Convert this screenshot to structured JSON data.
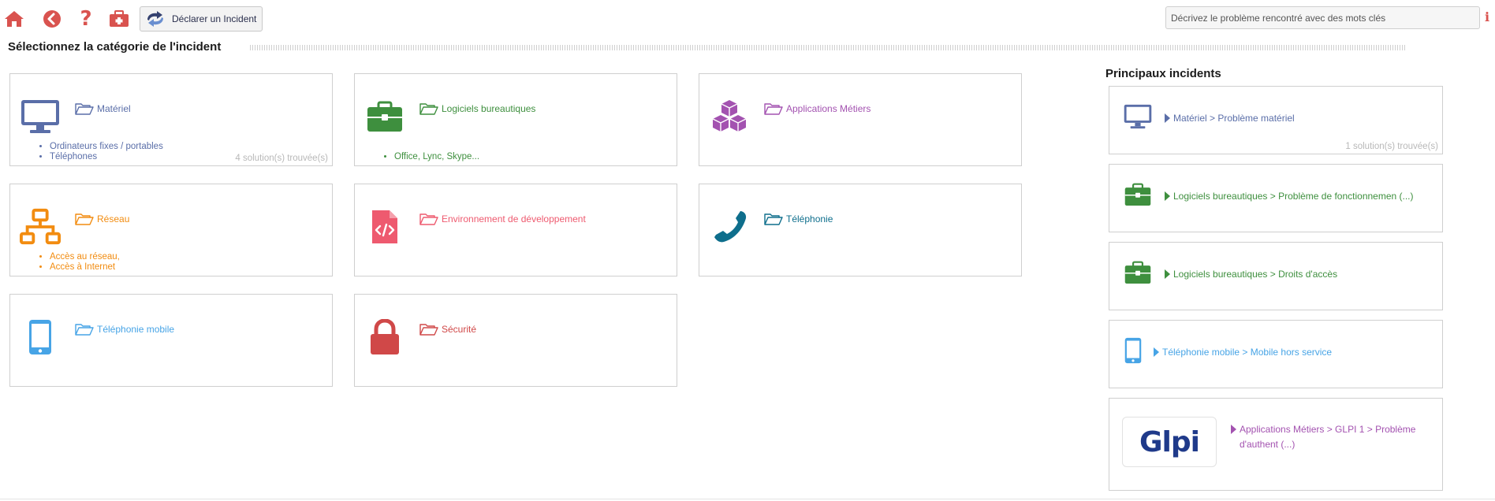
{
  "toolbar": {
    "home_icon": "home-icon",
    "back_icon": "back-icon",
    "help_icon": "help-icon",
    "medkit_icon": "medkit-icon",
    "declare_label": "Déclarer un Incident",
    "search_placeholder": "Décrivez le problème rencontré avec des mots clés",
    "accent": "#d9534f"
  },
  "page": {
    "title": "Sélectionnez la catégorie de l'incident"
  },
  "categories": [
    {
      "name": "Matériel",
      "color": "#5a6ea8",
      "icon": "monitor-icon",
      "items": [
        "Ordinateurs fixes / portables",
        "Téléphones"
      ],
      "solutions": "4 solution(s) trouvée(s)"
    },
    {
      "name": "Logiciels bureautiques",
      "color": "#3e8f3e",
      "icon": "briefcase-icon",
      "items": [
        "Office, Lync, Skype..."
      ]
    },
    {
      "name": "Applications Métiers",
      "color": "#a352b0",
      "icon": "cubes-icon",
      "items": []
    },
    {
      "name": "Réseau",
      "color": "#f28c10",
      "icon": "network-icon",
      "items": [
        "Accès au réseau,",
        "Accès à Internet"
      ]
    },
    {
      "name": "Environnement de développement",
      "color": "#ee5a6f",
      "icon": "code-file-icon",
      "items": []
    },
    {
      "name": "Téléphonie",
      "color": "#0e6e8c",
      "icon": "phone-icon",
      "items": []
    },
    {
      "name": "Téléphonie mobile",
      "color": "#47a4e6",
      "icon": "mobile-icon",
      "items": []
    },
    {
      "name": "Sécurité",
      "color": "#d04848",
      "icon": "lock-icon",
      "items": []
    }
  ],
  "top_incidents": {
    "title": "Principaux incidents",
    "items": [
      {
        "text": "Matériel > Problème matériel",
        "color": "#5a6ea8",
        "icon": "monitor-icon",
        "solutions": "1 solution(s) trouvée(s)"
      },
      {
        "text": "Logiciels bureautiques > Problème de fonctionnemen (...)",
        "color": "#3e8f3e",
        "icon": "briefcase-icon"
      },
      {
        "text": "Logiciels bureautiques > Droits d'accès",
        "color": "#3e8f3e",
        "icon": "briefcase-icon"
      },
      {
        "text": "Téléphonie mobile > Mobile hors service",
        "color": "#47a4e6",
        "icon": "mobile-icon"
      },
      {
        "text": "Applications Métiers > GLPI 1 > Problème d'authent (...)",
        "color": "#a352b0",
        "icon": "glpi-logo",
        "logo_text": "Glpi"
      }
    ]
  }
}
